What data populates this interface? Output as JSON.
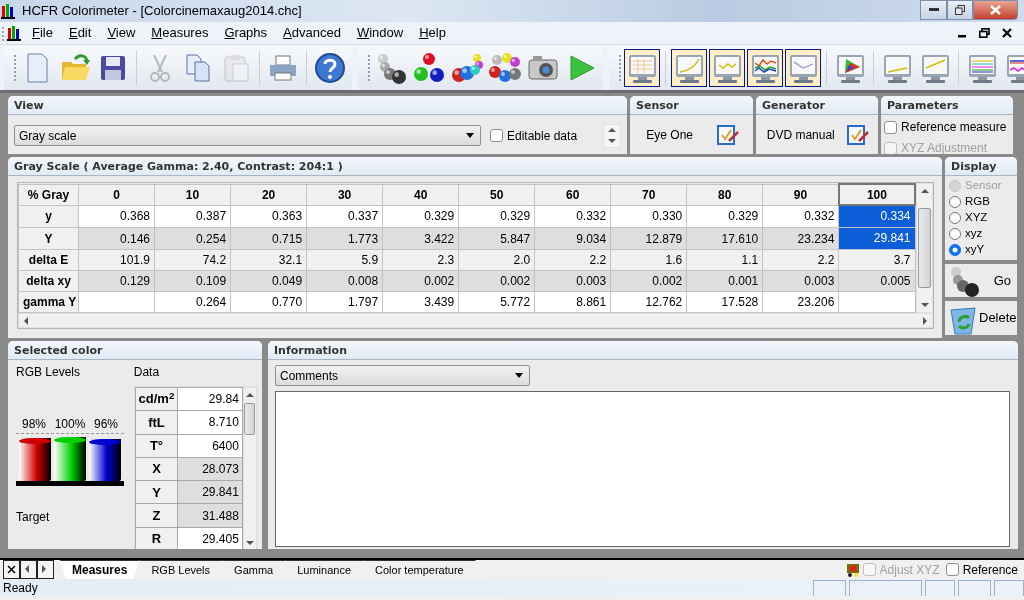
{
  "window": {
    "title": "HCFR Colorimeter - [Colorcinemaxaug2014.chc]"
  },
  "menu": [
    "File",
    "Edit",
    "View",
    "Measures",
    "Graphs",
    "Advanced",
    "Window",
    "Help"
  ],
  "toolbars": [
    [
      {
        "kind": "new",
        "disabled": false
      },
      {
        "kind": "open",
        "disabled": false
      },
      {
        "kind": "save",
        "disabled": false
      },
      {
        "kind": "separator"
      },
      {
        "kind": "cut",
        "disabled": true
      },
      {
        "kind": "copy",
        "disabled": false
      },
      {
        "kind": "paste",
        "disabled": true
      },
      {
        "kind": "separator"
      },
      {
        "kind": "print",
        "disabled": false
      },
      {
        "kind": "separator"
      },
      {
        "kind": "help",
        "disabled": false
      }
    ],
    [
      {
        "kind": "gray-spheres"
      },
      {
        "kind": "primary-spheres"
      },
      {
        "kind": "secondary-spheres"
      },
      {
        "kind": "sphere-ring"
      },
      {
        "kind": "camera"
      },
      {
        "kind": "play"
      }
    ],
    [
      {
        "kind": "monitor-table",
        "selected": true
      },
      {
        "kind": "separator"
      },
      {
        "kind": "monitor-curve",
        "selected": true
      },
      {
        "kind": "monitor-wave",
        "selected": true
      },
      {
        "kind": "monitor-multi",
        "selected": true
      },
      {
        "kind": "monitor-trend",
        "selected": true
      },
      {
        "kind": "separator"
      },
      {
        "kind": "monitor-gamut",
        "selected": false
      },
      {
        "kind": "separator"
      },
      {
        "kind": "monitor-low",
        "selected": false
      },
      {
        "kind": "monitor-high",
        "selected": false
      },
      {
        "kind": "separator"
      },
      {
        "kind": "monitor-lines",
        "selected": false
      },
      {
        "kind": "monitor-lines2",
        "selected": false
      }
    ]
  ],
  "view_panel": {
    "title": "View",
    "selection": "Gray scale",
    "editable_data": {
      "label": "Editable data",
      "checked": false
    }
  },
  "sensor_panel": {
    "title": "Sensor",
    "value": "Eye One"
  },
  "generator_panel": {
    "title": "Generator",
    "value": "DVD manual"
  },
  "parameters_panel": {
    "title": "Parameters",
    "options": [
      {
        "label": "Reference measure",
        "checked": false,
        "disabled": false
      },
      {
        "label": "XYZ Adjustment",
        "checked": false,
        "disabled": true
      }
    ]
  },
  "grid_panel": {
    "title": "Gray Scale ( Average Gamma: 2.40, Contrast: 204:1 )",
    "corner": "% Gray",
    "columns": [
      {
        "label": "0",
        "selected": false
      },
      {
        "label": "10",
        "selected": false
      },
      {
        "label": "20",
        "selected": false
      },
      {
        "label": "30",
        "selected": false
      },
      {
        "label": "40",
        "selected": false
      },
      {
        "label": "50",
        "selected": false
      },
      {
        "label": "60",
        "selected": false
      },
      {
        "label": "70",
        "selected": false
      },
      {
        "label": "80",
        "selected": false
      },
      {
        "label": "90",
        "selected": false
      },
      {
        "label": "100",
        "selected": true
      }
    ],
    "rows": [
      {
        "label": "y",
        "selected": true,
        "cells": [
          "0.368",
          "0.387",
          "0.363",
          "0.337",
          "0.329",
          "0.329",
          "0.332",
          "0.330",
          "0.329",
          "0.332",
          "0.334"
        ]
      },
      {
        "label": "Y",
        "selected": true,
        "cells": [
          "0.146",
          "0.254",
          "0.715",
          "1.773",
          "3.422",
          "5.847",
          "9.034",
          "12.879",
          "17.610",
          "23.234",
          "29.841"
        ]
      },
      {
        "label": "delta E",
        "selected": false,
        "cells": [
          "101.9",
          "74.2",
          "32.1",
          "5.9",
          "2.3",
          "2.0",
          "2.2",
          "1.6",
          "1.1",
          "2.2",
          "3.7"
        ]
      },
      {
        "label": "delta xy",
        "selected": false,
        "cells": [
          "0.129",
          "0.109",
          "0.049",
          "0.008",
          "0.002",
          "0.002",
          "0.003",
          "0.002",
          "0.001",
          "0.003",
          "0.005"
        ]
      },
      {
        "label": "gamma Y",
        "selected": false,
        "cells": [
          null,
          "0.264",
          "0.770",
          "1.797",
          "3.439",
          "5.772",
          "8.861",
          "12.762",
          "17.528",
          "23.206",
          null
        ]
      }
    ]
  },
  "display_panel": {
    "title": "Display",
    "options": [
      {
        "label": "Sensor",
        "selected": false,
        "disabled": true
      },
      {
        "label": "RGB",
        "selected": false,
        "disabled": false
      },
      {
        "label": "XYZ",
        "selected": false,
        "disabled": false
      },
      {
        "label": "xyz",
        "selected": false,
        "disabled": false
      },
      {
        "label": "xyY",
        "selected": true,
        "disabled": false
      }
    ]
  },
  "actions": [
    {
      "kind": "go",
      "label": "Go"
    },
    {
      "kind": "delete",
      "label": "Delete"
    }
  ],
  "selected_color": {
    "title": "Selected color",
    "levels_label": "RGB Levels",
    "data_label": "Data",
    "target_label": "Target",
    "levels": [
      {
        "reading": "98%",
        "level": 0.98,
        "color": "#d00000"
      },
      {
        "reading": "100%",
        "level": 1,
        "color": "#00d000"
      },
      {
        "reading": "96%",
        "level": 0.96,
        "color": "#0000d0"
      }
    ],
    "data": [
      {
        "label": "cd/m$^{2}$",
        "value": "29.84"
      },
      {
        "label": "ftL",
        "value": "8.710"
      },
      {
        "label": "T°",
        "value": "6400"
      },
      {
        "label": "X",
        "value": "28.073"
      },
      {
        "label": "Y",
        "value": "29.841"
      },
      {
        "label": "Z",
        "value": "31.488"
      },
      {
        "label": "R",
        "value": "29.405"
      }
    ]
  },
  "information": {
    "title": "Information",
    "selection": "Comments"
  },
  "tabs": [
    {
      "label": "Measures",
      "selected": true
    },
    {
      "label": "RGB Levels",
      "selected": false
    },
    {
      "label": "Gamma",
      "selected": false
    },
    {
      "label": "Luminance",
      "selected": false
    },
    {
      "label": "Color temperature",
      "selected": false
    }
  ],
  "tab_bar_options": [
    {
      "label": "Adjust XYZ",
      "checked": false,
      "disabled": true
    },
    {
      "label": "Reference",
      "checked": false,
      "disabled": false
    }
  ],
  "status_bar": {
    "text": "Ready"
  }
}
